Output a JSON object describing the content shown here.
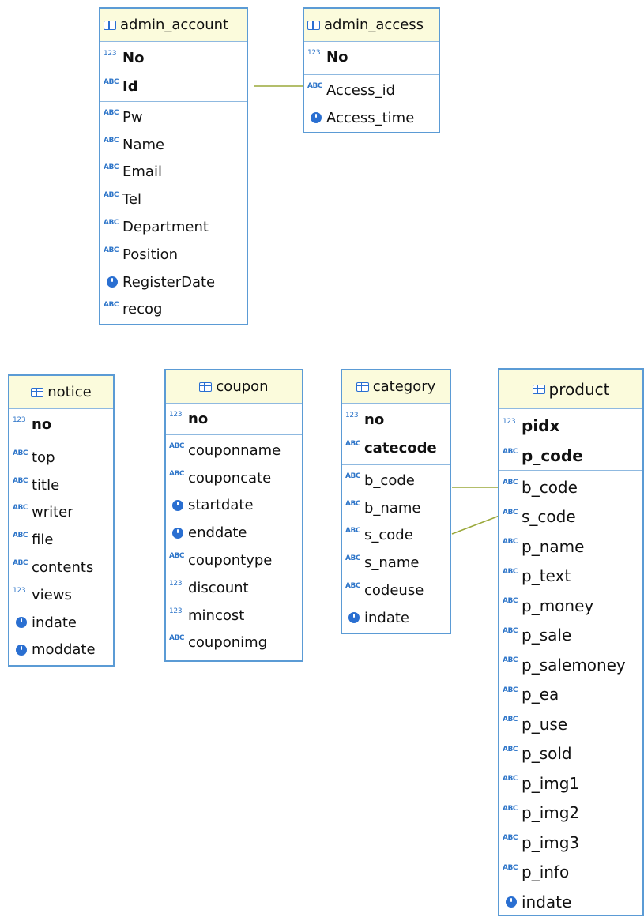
{
  "entities": {
    "admin_account": {
      "name": "admin_account",
      "keys": [
        {
          "type": "num",
          "label": "No"
        },
        {
          "type": "text",
          "label": "Id"
        }
      ],
      "fields": [
        {
          "type": "text",
          "label": "Pw"
        },
        {
          "type": "text",
          "label": "Name"
        },
        {
          "type": "text",
          "label": "Email"
        },
        {
          "type": "text",
          "label": "Tel"
        },
        {
          "type": "text",
          "label": "Department"
        },
        {
          "type": "text",
          "label": "Position"
        },
        {
          "type": "date",
          "label": "RegisterDate"
        },
        {
          "type": "text",
          "label": "recog"
        }
      ]
    },
    "admin_access": {
      "name": "admin_access",
      "keys": [
        {
          "type": "num",
          "label": "No"
        }
      ],
      "fields": [
        {
          "type": "text",
          "label": "Access_id"
        },
        {
          "type": "date",
          "label": "Access_time"
        }
      ]
    },
    "notice": {
      "name": "notice",
      "keys": [
        {
          "type": "num",
          "label": "no"
        }
      ],
      "fields": [
        {
          "type": "text",
          "label": "top"
        },
        {
          "type": "text",
          "label": "title"
        },
        {
          "type": "text",
          "label": "writer"
        },
        {
          "type": "text",
          "label": "file"
        },
        {
          "type": "text",
          "label": "contents"
        },
        {
          "type": "num",
          "label": "views"
        },
        {
          "type": "date",
          "label": "indate"
        },
        {
          "type": "date",
          "label": "moddate"
        }
      ]
    },
    "coupon": {
      "name": "coupon",
      "keys": [
        {
          "type": "num",
          "label": "no"
        }
      ],
      "fields": [
        {
          "type": "text",
          "label": "couponname"
        },
        {
          "type": "text",
          "label": "couponcate"
        },
        {
          "type": "date",
          "label": "startdate"
        },
        {
          "type": "date",
          "label": "enddate"
        },
        {
          "type": "text",
          "label": "coupontype"
        },
        {
          "type": "num",
          "label": "discount"
        },
        {
          "type": "num",
          "label": "mincost"
        },
        {
          "type": "text",
          "label": "couponimg"
        }
      ]
    },
    "category": {
      "name": "category",
      "keys": [
        {
          "type": "num",
          "label": "no"
        },
        {
          "type": "text",
          "label": "catecode"
        }
      ],
      "fields": [
        {
          "type": "text",
          "label": "b_code"
        },
        {
          "type": "text",
          "label": "b_name"
        },
        {
          "type": "text",
          "label": "s_code"
        },
        {
          "type": "text",
          "label": "s_name"
        },
        {
          "type": "text",
          "label": "codeuse"
        },
        {
          "type": "date",
          "label": "indate"
        }
      ]
    },
    "product": {
      "name": "product",
      "keys": [
        {
          "type": "num",
          "label": "pidx"
        },
        {
          "type": "text",
          "label": "p_code"
        }
      ],
      "fields": [
        {
          "type": "text",
          "label": "b_code"
        },
        {
          "type": "text",
          "label": "s_code"
        },
        {
          "type": "text",
          "label": "p_name"
        },
        {
          "type": "text",
          "label": "p_text"
        },
        {
          "type": "text",
          "label": "p_money"
        },
        {
          "type": "text",
          "label": "p_sale"
        },
        {
          "type": "text",
          "label": "p_salemoney"
        },
        {
          "type": "text",
          "label": "p_ea"
        },
        {
          "type": "text",
          "label": "p_use"
        },
        {
          "type": "text",
          "label": "p_sold"
        },
        {
          "type": "text",
          "label": "p_img1"
        },
        {
          "type": "text",
          "label": "p_img2"
        },
        {
          "type": "text",
          "label": "p_img3"
        },
        {
          "type": "text",
          "label": "p_info"
        },
        {
          "type": "date",
          "label": "indate"
        }
      ]
    }
  },
  "glyphs": {
    "text": "ABC",
    "num": "123"
  },
  "icons": {
    "table": "table-icon",
    "text_type": "text-type-icon",
    "numeric_type": "numeric-type-icon",
    "date_type": "clock-icon",
    "key": "key-icon"
  },
  "colors": {
    "border": "#5b9bd5",
    "header_bg": "#fbfbdc",
    "link": "#9aa83a",
    "icon": "#2a6fd1"
  }
}
